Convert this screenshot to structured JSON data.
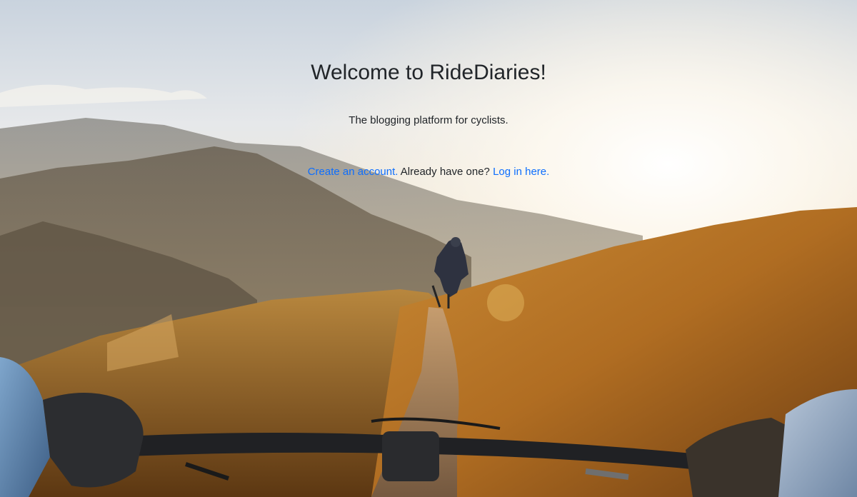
{
  "page": {
    "title": "Welcome to RideDiaries!",
    "subtitle": "The blogging platform for cyclists.",
    "create_account_link": "Create an account.",
    "have_account_text": " Already have one? ",
    "login_link": "Log in here."
  },
  "hero": {
    "alt": "Mountain biker riding down a grassy ridge at sunset"
  },
  "colors": {
    "link": "#0d6efd",
    "text": "#212529"
  }
}
